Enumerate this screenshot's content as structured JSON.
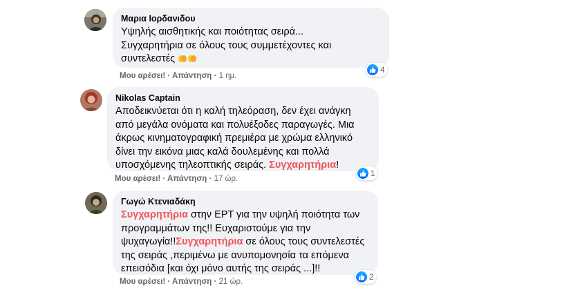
{
  "comments": [
    {
      "author": "Μαρια Ιορδανιδου",
      "lines": [
        "Υψηλής αισθητικής και ποιότητας σειρά...",
        "Συγχαρητήρια σε όλους τους συμμετέχοντες και",
        "συντελεστές"
      ],
      "like_label": "Μου αρέσει!",
      "reply_label": "Απάντηση",
      "time": "1 ημ.",
      "reaction_count": "4"
    },
    {
      "author": "Nikolas Captain",
      "lines": [
        "Αποδεικνύεται ότι η καλή τηλεόραση, δεν έχει ανάγκη",
        "από μεγάλα ονόματα και πολυέξοδες παραγωγές. Μια",
        "άκρως κινηματογραφική πρεμιέρα με χρώμα ελληνικό",
        "δίνει την εικόνα μιας καλά δουλεμένης και πολλά",
        "υποσχόμενης τηλεοπτικής σειράς. ",
        "Συγχαρητήρια",
        "!"
      ],
      "like_label": "Μου αρέσει!",
      "reply_label": "Απάντηση",
      "time": "17 ώρ.",
      "reaction_count": "1"
    },
    {
      "author": "Γωγώ Κτενιαδάκη",
      "lines": [
        "Συγχαρητήρια",
        " στην ΕΡΤ για την υψηλή ποιότητα των",
        "προγραμμάτων της!! Ευχαριστούμε για την",
        "ψυχαγωγία!!",
        "Συγχαρητήρια",
        " σε όλους τους συντελεστές",
        "της σειράς ,περιμένω με ανυπομονησία τα επόμενα",
        "επεισόδια [και όχι μόνο αυτής της σειράς ...]!!"
      ],
      "like_label": "Μου αρέσει!",
      "reply_label": "Απάντηση",
      "time": "21 ώρ.",
      "reaction_count": "2"
    }
  ],
  "separator": " · ",
  "reaction_icon": "like-icon",
  "emoji": "clapping-hands",
  "colors": {
    "bubble": "#f0f2f5",
    "highlight": "#f2545b",
    "like_blue": "#0866ff",
    "meta_gray": "#65676b"
  }
}
